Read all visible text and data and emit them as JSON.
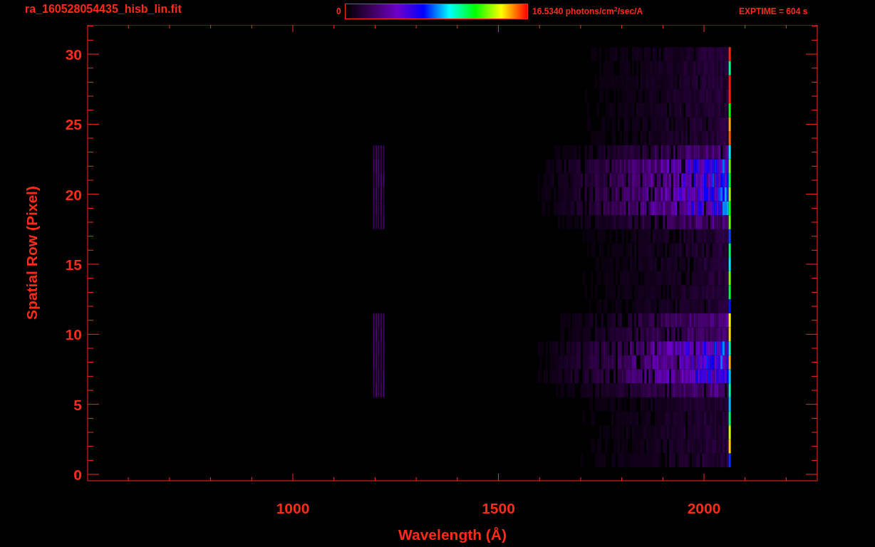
{
  "title": "ra_160528054435_hisb_lin.fit",
  "colorbar": {
    "min_label": "0",
    "max_label": "16.5340 photons/cm$^{2}$/sec/A"
  },
  "exposure": "EXPTIME = 604 s",
  "plot": {
    "xlabel": "Wavelength (Å)",
    "ylabel": "Spatial Row (Pixel)",
    "xticks": [
      "1000",
      "1500",
      "2000"
    ],
    "yticks": [
      "30",
      "25",
      "20",
      "15",
      "10",
      "5",
      "0"
    ]
  }
}
